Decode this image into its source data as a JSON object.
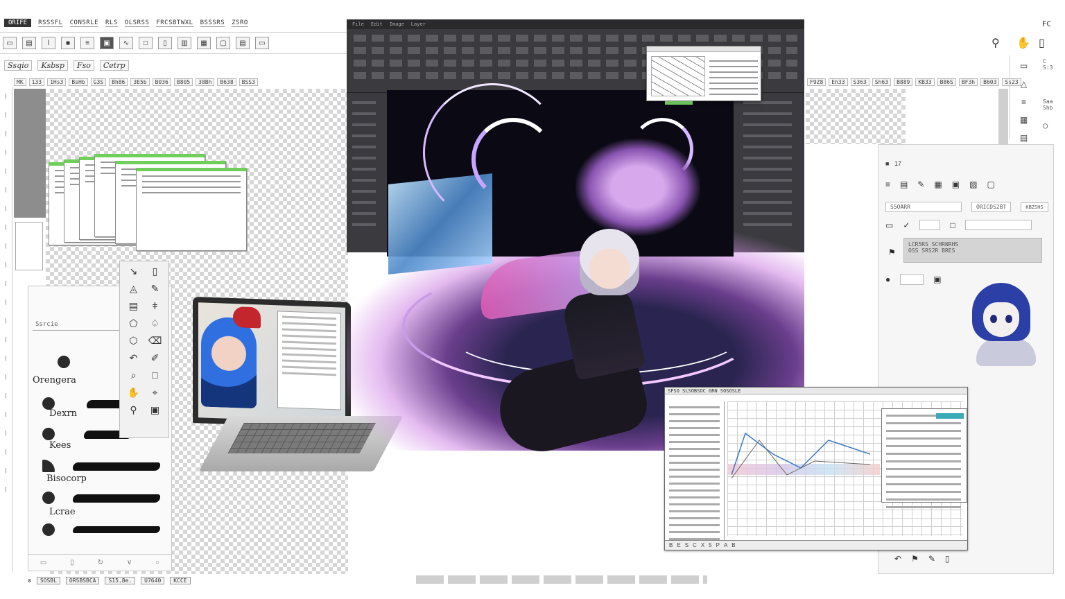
{
  "menubar": {
    "items": [
      "ORIFE",
      "RSSSFL",
      "CONSRLE",
      "RLS",
      "OLSRSS",
      "FRCSBTWXL",
      "BSSSRS",
      "ZSRO"
    ],
    "active_index": 0
  },
  "options_bar": {
    "items": [
      "Ssqio",
      "Ksbsp",
      "Fso",
      "Cetrp"
    ]
  },
  "left_tabs": [
    "MK",
    "133",
    "1Hs3",
    "BsHb",
    "G3S",
    "Bh86",
    "3E5b",
    "B036",
    "B805",
    "38Bh",
    "B638",
    "BSS3"
  ],
  "right_tabs": [
    "F9Z8",
    "Eh33",
    "S363",
    "Sh63",
    "B889",
    "KB33",
    "B86S",
    "BF3h",
    "B603",
    "Ss23"
  ],
  "brush_panel": {
    "search_placeholder": "Ssrcie",
    "brushes": [
      "Orengera",
      "Dexrn",
      "Kees",
      "Bisocorp",
      "Lcrae"
    ]
  },
  "dark_app": {
    "tabs": [
      "File",
      "Edit",
      "Image",
      "Layer"
    ]
  },
  "right_chrome": {
    "corner_label": "FC"
  },
  "right_strip_labels": [
    "C",
    "S:3",
    "Saa",
    "Shb"
  ],
  "properties": {
    "header": "17",
    "field1": "S5OARR",
    "field2": "ORICDS2BT",
    "field3": "KBZSHS",
    "graybox_line1": "LCR5RS SCHRNRHS",
    "graybox_line2": "OSS SRS2R BRES"
  },
  "timeline": {
    "title": "SFSO SLSOBSOC GRN SOSOSLE",
    "footer": [
      "B",
      "E",
      "S",
      "C",
      "X",
      "5",
      "P",
      "A",
      "B"
    ]
  },
  "status_left": [
    "SOSBL",
    "ORSBSBCA",
    "S15.8e.",
    "U7640",
    "KCCE"
  ],
  "status_right_icons": [
    "undo-icon",
    "flag-icon",
    "brush-icon",
    "bookmark-icon"
  ],
  "colors": {
    "accent_green": "#6fcf5a",
    "dark_ui": "#3b3b3f",
    "teal": "#3aa9b8"
  }
}
